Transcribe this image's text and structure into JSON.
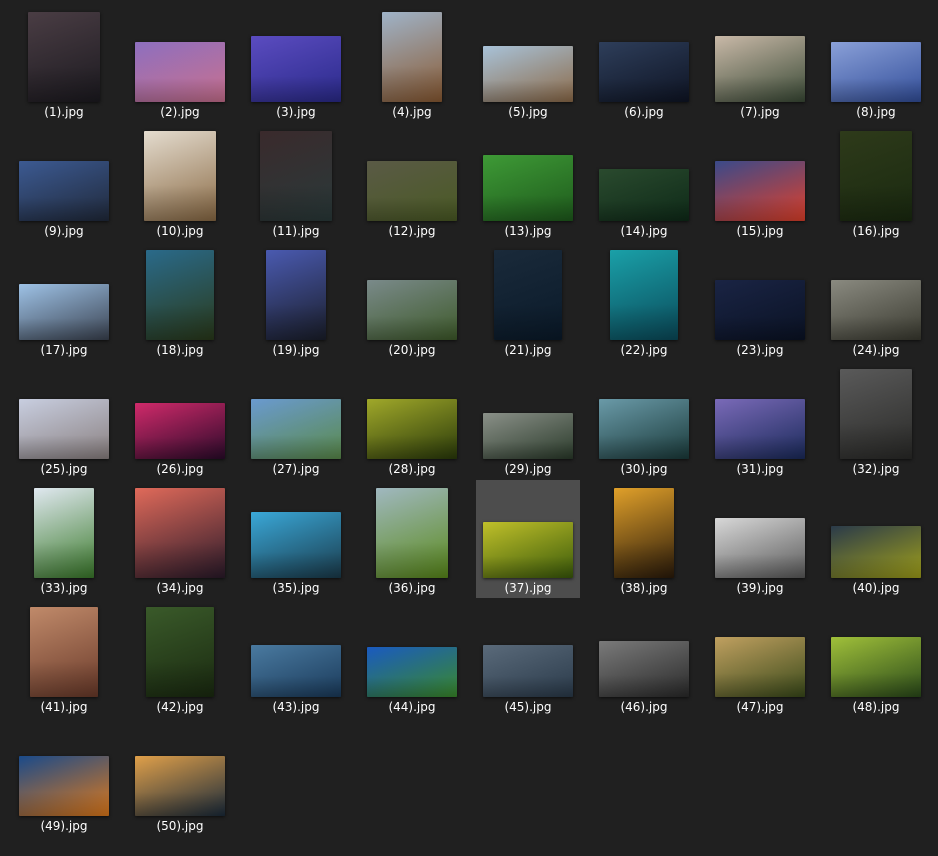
{
  "files": [
    {
      "name": "(1).jpg",
      "w": 72,
      "h": 90,
      "c1": "#4a3d44",
      "c2": "#1c1a20"
    },
    {
      "name": "(2).jpg",
      "w": 90,
      "h": 60,
      "c1": "#8d6fbf",
      "c2": "#c9708e"
    },
    {
      "name": "(3).jpg",
      "w": 90,
      "h": 66,
      "c1": "#5b4cc0",
      "c2": "#2a2a8a"
    },
    {
      "name": "(4).jpg",
      "w": 60,
      "h": 90,
      "c1": "#9fb3c8",
      "c2": "#8a5a32"
    },
    {
      "name": "(5).jpg",
      "w": 90,
      "h": 56,
      "c1": "#a8c2d8",
      "c2": "#8c6a48"
    },
    {
      "name": "(6).jpg",
      "w": 90,
      "h": 60,
      "c1": "#2e3e5a",
      "c2": "#0e1424"
    },
    {
      "name": "(7).jpg",
      "w": 90,
      "h": 66,
      "c1": "#c9b9a8",
      "c2": "#3a4a36"
    },
    {
      "name": "(8).jpg",
      "w": 90,
      "h": 60,
      "c1": "#8aa0d8",
      "c2": "#324e9a"
    },
    {
      "name": "(9).jpg",
      "w": 90,
      "h": 60,
      "c1": "#3c5a92",
      "c2": "#20293a"
    },
    {
      "name": "(10).jpg",
      "w": 72,
      "h": 90,
      "c1": "#e4dccf",
      "c2": "#8a6a44"
    },
    {
      "name": "(11).jpg",
      "w": 72,
      "h": 90,
      "c1": "#3a2a2c",
      "c2": "#2a3a3a"
    },
    {
      "name": "(12).jpg",
      "w": 90,
      "h": 60,
      "c1": "#5a5a46",
      "c2": "#4a5a24"
    },
    {
      "name": "(13).jpg",
      "w": 90,
      "h": 66,
      "c1": "#3e9a36",
      "c2": "#1e5a1c"
    },
    {
      "name": "(14).jpg",
      "w": 90,
      "h": 52,
      "c1": "#2a4a2e",
      "c2": "#0e2a18"
    },
    {
      "name": "(15).jpg",
      "w": 90,
      "h": 60,
      "c1": "#3a4a8a",
      "c2": "#e0402a"
    },
    {
      "name": "(16).jpg",
      "w": 72,
      "h": 90,
      "c1": "#2e3a1a",
      "c2": "#1a2a10"
    },
    {
      "name": "(17).jpg",
      "w": 90,
      "h": 56,
      "c1": "#9ec2e6",
      "c2": "#3a4250"
    },
    {
      "name": "(18).jpg",
      "w": 68,
      "h": 90,
      "c1": "#2a6a8a",
      "c2": "#2a3a1a"
    },
    {
      "name": "(19).jpg",
      "w": 60,
      "h": 90,
      "c1": "#4a5ab0",
      "c2": "#1a1e2a"
    },
    {
      "name": "(20).jpg",
      "w": 90,
      "h": 60,
      "c1": "#7a8a8a",
      "c2": "#3e5a2a"
    },
    {
      "name": "(21).jpg",
      "w": 68,
      "h": 90,
      "c1": "#1a2a3a",
      "c2": "#0a1a2a"
    },
    {
      "name": "(22).jpg",
      "w": 68,
      "h": 90,
      "c1": "#1aa0a8",
      "c2": "#0a4a5a"
    },
    {
      "name": "(23).jpg",
      "w": 90,
      "h": 60,
      "c1": "#1a2444",
      "c2": "#0a1224"
    },
    {
      "name": "(24).jpg",
      "w": 90,
      "h": 60,
      "c1": "#8a8a80",
      "c2": "#3a3a30"
    },
    {
      "name": "(25).jpg",
      "w": 90,
      "h": 60,
      "c1": "#c8cee0",
      "c2": "#8a8080"
    },
    {
      "name": "(26).jpg",
      "w": 90,
      "h": 56,
      "c1": "#d02a6a",
      "c2": "#2a0a2a"
    },
    {
      "name": "(27).jpg",
      "w": 90,
      "h": 60,
      "c1": "#6a9ad0",
      "c2": "#5a8a4a"
    },
    {
      "name": "(28).jpg",
      "w": 90,
      "h": 60,
      "c1": "#a0a82a",
      "c2": "#2a3a0a"
    },
    {
      "name": "(29).jpg",
      "w": 90,
      "h": 46,
      "c1": "#8a9088",
      "c2": "#2a3a2a"
    },
    {
      "name": "(30).jpg",
      "w": 90,
      "h": 60,
      "c1": "#6a9aa8",
      "c2": "#1a3a3a"
    },
    {
      "name": "(31).jpg",
      "w": 90,
      "h": 60,
      "c1": "#7a6ab8",
      "c2": "#1a2a5a"
    },
    {
      "name": "(32).jpg",
      "w": 72,
      "h": 90,
      "c1": "#5a5a5a",
      "c2": "#2a2a28"
    },
    {
      "name": "(33).jpg",
      "w": 60,
      "h": 90,
      "c1": "#e0e8f0",
      "c2": "#3a7a2a"
    },
    {
      "name": "(34).jpg",
      "w": 90,
      "h": 90,
      "c1": "#e06a5a",
      "c2": "#2a1a2a"
    },
    {
      "name": "(35).jpg",
      "w": 90,
      "h": 66,
      "c1": "#3aa8d8",
      "c2": "#1a3a4a"
    },
    {
      "name": "(36).jpg",
      "w": 72,
      "h": 90,
      "c1": "#a0b8c0",
      "c2": "#5a8a1a"
    },
    {
      "name": "(37).jpg",
      "w": 90,
      "h": 56,
      "c1": "#c0c02a",
      "c2": "#3a5a0a"
    },
    {
      "name": "(38).jpg",
      "w": 60,
      "h": 90,
      "c1": "#e0a02a",
      "c2": "#2a1a0a"
    },
    {
      "name": "(39).jpg",
      "w": 90,
      "h": 60,
      "c1": "#d8d8d8",
      "c2": "#5a5a5a"
    },
    {
      "name": "(40).jpg",
      "w": 90,
      "h": 52,
      "c1": "#2a3a4a",
      "c2": "#a0a01a"
    },
    {
      "name": "(41).jpg",
      "w": 68,
      "h": 90,
      "c1": "#c08a6a",
      "c2": "#6a3a2a"
    },
    {
      "name": "(42).jpg",
      "w": 68,
      "h": 90,
      "c1": "#3a5a2a",
      "c2": "#1a2a10"
    },
    {
      "name": "(43).jpg",
      "w": 90,
      "h": 52,
      "c1": "#4a7aa0",
      "c2": "#1a3a5a"
    },
    {
      "name": "(44).jpg",
      "w": 90,
      "h": 50,
      "c1": "#1a5ac0",
      "c2": "#3a8a2a"
    },
    {
      "name": "(45).jpg",
      "w": 90,
      "h": 52,
      "c1": "#5a6a7a",
      "c2": "#2a3a4a"
    },
    {
      "name": "(46).jpg",
      "w": 90,
      "h": 56,
      "c1": "#7a7a7a",
      "c2": "#2a2a2a"
    },
    {
      "name": "(47).jpg",
      "w": 90,
      "h": 60,
      "c1": "#c0a060",
      "c2": "#3a4a1a"
    },
    {
      "name": "(48).jpg",
      "w": 90,
      "h": 60,
      "c1": "#a0c03a",
      "c2": "#2a4a1a"
    },
    {
      "name": "(49).jpg",
      "w": 90,
      "h": 60,
      "c1": "#1a4a8a",
      "c2": "#e07a1a"
    },
    {
      "name": "(50).jpg",
      "w": 90,
      "h": 60,
      "c1": "#e0a04a",
      "c2": "#1a2a3a"
    }
  ],
  "selected": "(37).jpg"
}
